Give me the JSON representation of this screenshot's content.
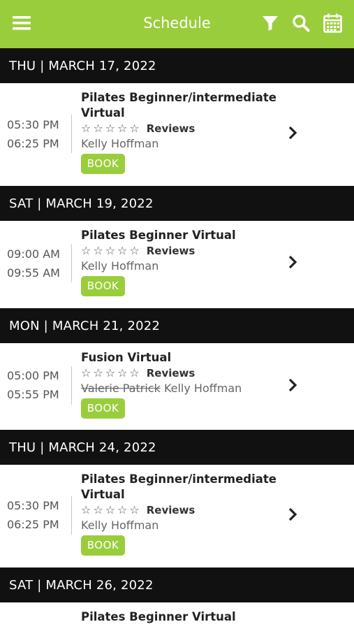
{
  "header": {
    "title": "Schedule",
    "menu_icon": "hamburger-menu-icon",
    "filter_icon": "filter-icon",
    "search_icon": "search-icon",
    "calendar_icon": "calendar-icon"
  },
  "colors": {
    "accent": "#9acd3c",
    "date_bar": "#111111"
  },
  "days": [
    {
      "date": "THU | MARCH 17, 2022",
      "class": {
        "name_line1": "Pilates Beginner/intermediate",
        "name_line2": "Virtual",
        "start": "05:30 PM",
        "end": "06:25 PM",
        "reviews_label": "Reviews",
        "instructor": "Kelly Hoffman",
        "book_label": "BOOK"
      }
    },
    {
      "date": "SAT | MARCH 19, 2022",
      "class": {
        "name_line1": "Pilates Beginner Virtual",
        "start": "09:00 AM",
        "end": "09:55 AM",
        "reviews_label": "Reviews",
        "instructor": "Kelly Hoffman",
        "book_label": "BOOK"
      }
    },
    {
      "date": "MON | MARCH 21, 2022",
      "class": {
        "name_line1": "Fusion Virtual",
        "start": "05:00 PM",
        "end": "05:55 PM",
        "reviews_label": "Reviews",
        "instructor_struck": "Valerie Patrick",
        "instructor": "Kelly Hoffman",
        "book_label": "BOOK"
      }
    },
    {
      "date": "THU | MARCH 24, 2022",
      "class": {
        "name_line1": "Pilates Beginner/intermediate",
        "name_line2": "Virtual",
        "start": "05:30 PM",
        "end": "06:25 PM",
        "reviews_label": "Reviews",
        "instructor": "Kelly Hoffman",
        "book_label": "BOOK"
      }
    },
    {
      "date": "SAT | MARCH 26, 2022",
      "class": {
        "name_line1": "Pilates Beginner Virtual"
      }
    }
  ]
}
